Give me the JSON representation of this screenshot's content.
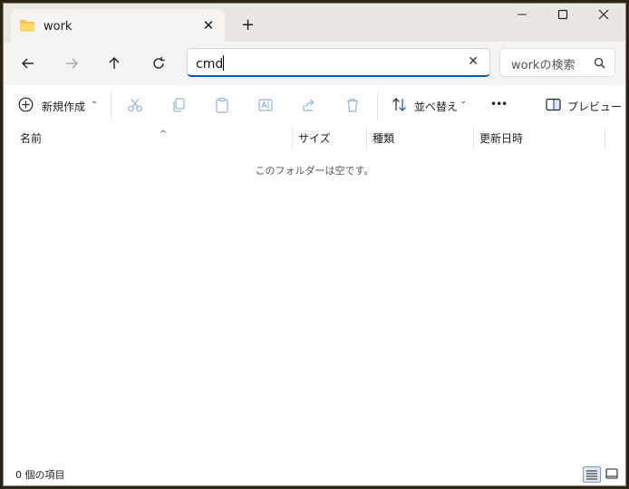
{
  "tab": {
    "title": "work",
    "close_glyph": "✕",
    "new_tab_glyph": "+"
  },
  "window_controls": {
    "minimize": "—",
    "maximize": "☐",
    "close": "✕"
  },
  "address": {
    "value": "cmd",
    "clear_glyph": "✕"
  },
  "search": {
    "placeholder": "workの検索"
  },
  "toolbar": {
    "new_label": "新規作成",
    "sort_label": "並べ替え",
    "more_glyph": "•••",
    "preview_label": "プレビュー",
    "chevron": "⌄"
  },
  "columns": {
    "name": "名前",
    "size": "サイズ",
    "type": "種類",
    "modified": "更新日時",
    "sort_glyph": "^"
  },
  "empty_message": "このフォルダーは空です。",
  "status": {
    "item_count": "0 個の項目"
  },
  "colors": {
    "accent": "#005fb8",
    "titlebar": "#e9e6e3",
    "navbar": "#f6f4f2",
    "folder": "#f5c242"
  }
}
